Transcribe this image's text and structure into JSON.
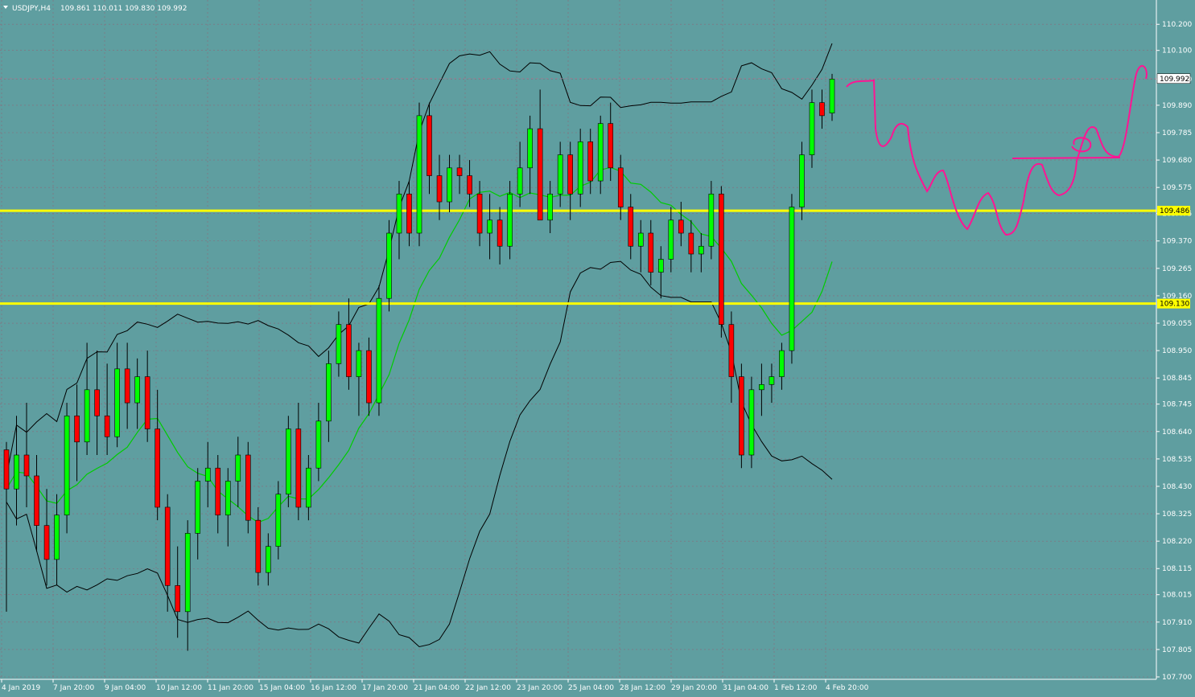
{
  "header": {
    "menu_arrow_icon": "triangle-down-icon",
    "symbol": "USDJPY,H4",
    "ohlc": "109.861 110.011 109.830 109.992"
  },
  "colors": {
    "background": "#5f9ea0",
    "bull": "#00ff00",
    "bear": "#ff0000",
    "wick": "#000000",
    "band": "#000000",
    "ma": "#00cc00",
    "level_line": "#ffff00",
    "drawing": "#ff1493",
    "grid": "#8a6a7a",
    "axis_text": "#ffffff"
  },
  "chart_data": {
    "type": "candlestick",
    "y_axis": {
      "min": 107.7,
      "max": 110.25,
      "ticks": [
        "110.200",
        "110.100",
        "109.990",
        "109.890",
        "109.785",
        "109.680",
        "109.575",
        "109.475",
        "109.370",
        "109.265",
        "109.160",
        "109.055",
        "108.950",
        "108.845",
        "108.745",
        "108.640",
        "108.535",
        "108.430",
        "108.325",
        "108.220",
        "108.115",
        "108.015",
        "107.910",
        "107.805",
        "107.700"
      ]
    },
    "x_axis": {
      "labels": [
        "4 Jan 2019",
        "7 Jan 20:00",
        "9 Jan 04:00",
        "10 Jan 12:00",
        "11 Jan 20:00",
        "15 Jan 04:00",
        "16 Jan 12:00",
        "17 Jan 20:00",
        "21 Jan 04:00",
        "22 Jan 12:00",
        "23 Jan 20:00",
        "25 Jan 04:00",
        "28 Jan 12:00",
        "29 Jan 20:00",
        "31 Jan 04:00",
        "1 Feb 12:00",
        "4 Feb 20:00"
      ]
    },
    "horizontal_levels": [
      {
        "price": 109.486,
        "label": "109.486"
      },
      {
        "price": 109.13,
        "label": "109.130"
      }
    ],
    "current_price": {
      "price": 109.992,
      "label": "109.992"
    },
    "candles": [
      [
        108.57,
        108.6,
        107.95,
        108.42
      ],
      [
        108.42,
        108.7,
        108.28,
        108.55
      ],
      [
        108.55,
        108.75,
        108.35,
        108.47
      ],
      [
        108.47,
        108.55,
        108.18,
        108.28
      ],
      [
        108.28,
        108.42,
        108.05,
        108.15
      ],
      [
        108.15,
        108.4,
        108.05,
        108.32
      ],
      [
        108.32,
        108.75,
        108.25,
        108.7
      ],
      [
        108.7,
        108.82,
        108.45,
        108.6
      ],
      [
        108.6,
        108.98,
        108.55,
        108.8
      ],
      [
        108.8,
        108.95,
        108.55,
        108.7
      ],
      [
        108.7,
        108.9,
        108.55,
        108.62
      ],
      [
        108.62,
        108.98,
        108.58,
        108.88
      ],
      [
        108.88,
        108.98,
        108.65,
        108.75
      ],
      [
        108.75,
        108.92,
        108.65,
        108.85
      ],
      [
        108.85,
        108.95,
        108.6,
        108.65
      ],
      [
        108.65,
        108.8,
        108.3,
        108.35
      ],
      [
        108.35,
        108.4,
        107.95,
        108.05
      ],
      [
        108.05,
        108.2,
        107.85,
        107.95
      ],
      [
        107.95,
        108.3,
        107.8,
        108.25
      ],
      [
        108.25,
        108.5,
        108.15,
        108.45
      ],
      [
        108.45,
        108.6,
        108.35,
        108.5
      ],
      [
        108.5,
        108.55,
        108.25,
        108.32
      ],
      [
        108.32,
        108.5,
        108.2,
        108.45
      ],
      [
        108.45,
        108.62,
        108.35,
        108.55
      ],
      [
        108.55,
        108.6,
        108.25,
        108.3
      ],
      [
        108.3,
        108.35,
        108.05,
        108.1
      ],
      [
        108.1,
        108.25,
        108.05,
        108.2
      ],
      [
        108.2,
        108.45,
        108.15,
        108.4
      ],
      [
        108.4,
        108.7,
        108.35,
        108.65
      ],
      [
        108.65,
        108.75,
        108.3,
        108.35
      ],
      [
        108.35,
        108.55,
        108.3,
        108.5
      ],
      [
        108.5,
        108.75,
        108.45,
        108.68
      ],
      [
        108.68,
        108.95,
        108.6,
        108.9
      ],
      [
        108.9,
        109.1,
        108.85,
        109.05
      ],
      [
        109.05,
        109.15,
        108.8,
        108.85
      ],
      [
        108.85,
        108.98,
        108.7,
        108.95
      ],
      [
        108.95,
        109.0,
        108.7,
        108.75
      ],
      [
        108.75,
        109.2,
        108.7,
        109.15
      ],
      [
        109.15,
        109.45,
        109.1,
        109.4
      ],
      [
        109.4,
        109.6,
        109.3,
        109.55
      ],
      [
        109.55,
        109.6,
        109.35,
        109.4
      ],
      [
        109.4,
        109.9,
        109.35,
        109.85
      ],
      [
        109.85,
        109.9,
        109.55,
        109.62
      ],
      [
        109.62,
        109.7,
        109.45,
        109.52
      ],
      [
        109.52,
        109.7,
        109.48,
        109.65
      ],
      [
        109.65,
        109.7,
        109.55,
        109.62
      ],
      [
        109.62,
        109.68,
        109.5,
        109.55
      ],
      [
        109.55,
        109.6,
        109.35,
        109.4
      ],
      [
        109.4,
        109.55,
        109.3,
        109.45
      ],
      [
        109.45,
        109.5,
        109.28,
        109.35
      ],
      [
        109.35,
        109.6,
        109.3,
        109.55
      ],
      [
        109.55,
        109.75,
        109.5,
        109.65
      ],
      [
        109.65,
        109.85,
        109.55,
        109.8
      ],
      [
        109.8,
        109.95,
        109.6,
        109.45
      ],
      [
        109.45,
        109.6,
        109.4,
        109.55
      ],
      [
        109.55,
        109.75,
        109.5,
        109.7
      ],
      [
        109.7,
        109.75,
        109.45,
        109.55
      ],
      [
        109.55,
        109.8,
        109.5,
        109.75
      ],
      [
        109.75,
        109.8,
        109.55,
        109.6
      ],
      [
        109.6,
        109.85,
        109.55,
        109.82
      ],
      [
        109.82,
        109.9,
        109.6,
        109.65
      ],
      [
        109.65,
        109.7,
        109.45,
        109.5
      ],
      [
        109.5,
        109.55,
        109.3,
        109.35
      ],
      [
        109.35,
        109.45,
        109.25,
        109.4
      ],
      [
        109.4,
        109.45,
        109.2,
        109.25
      ],
      [
        109.25,
        109.35,
        109.15,
        109.3
      ],
      [
        109.3,
        109.5,
        109.25,
        109.45
      ],
      [
        109.45,
        109.52,
        109.35,
        109.4
      ],
      [
        109.4,
        109.45,
        109.25,
        109.32
      ],
      [
        109.32,
        109.4,
        109.25,
        109.35
      ],
      [
        109.35,
        109.6,
        109.3,
        109.55
      ],
      [
        109.55,
        109.58,
        109.0,
        109.05
      ],
      [
        109.05,
        109.1,
        108.75,
        108.85
      ],
      [
        108.85,
        108.9,
        108.5,
        108.55
      ],
      [
        108.55,
        108.85,
        108.5,
        108.8
      ],
      [
        108.8,
        108.9,
        108.7,
        108.82
      ],
      [
        108.82,
        108.9,
        108.75,
        108.85
      ],
      [
        108.85,
        108.98,
        108.8,
        108.95
      ],
      [
        108.95,
        109.55,
        108.9,
        109.5
      ],
      [
        109.5,
        109.75,
        109.45,
        109.7
      ],
      [
        109.7,
        109.95,
        109.65,
        109.9
      ],
      [
        109.9,
        109.95,
        109.8,
        109.85
      ],
      [
        109.86,
        110.01,
        109.83,
        109.99
      ]
    ]
  },
  "annotations": {
    "drawing_desc": "pink hand-drawn projection line"
  }
}
